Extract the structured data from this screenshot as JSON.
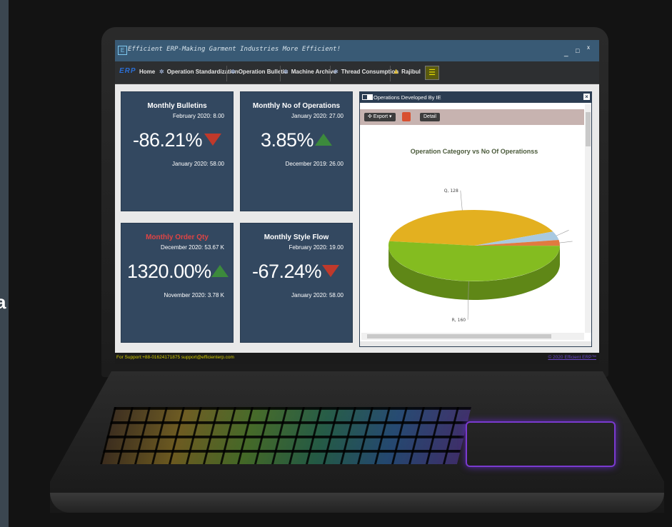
{
  "left_fragment": "a",
  "window": {
    "title": "Efficient ERP-Making Garment Industries More Efficient!",
    "controls": [
      "_",
      "□",
      "x"
    ]
  },
  "menu": {
    "logo": "ERP",
    "items": [
      {
        "label": "Home",
        "icon": "home-icon"
      },
      {
        "label": "Operation Standardization",
        "icon": "gears-icon"
      },
      {
        "label": "Operation Bulletin",
        "icon": "gears-icon"
      },
      {
        "label": "Machine Archive",
        "icon": "gears-icon"
      },
      {
        "label": "Thread Consumption",
        "icon": "gears-icon"
      },
      {
        "label": "Rajibul",
        "icon": "user-icon"
      }
    ]
  },
  "cards": [
    {
      "title": "Monthly Bulletins",
      "current": "February 2020: 8.00",
      "change": "-86.21%",
      "trend": "down",
      "previous": "January 2020: 58.00"
    },
    {
      "title": "Monthly No of Operations",
      "current": "January 2020: 27.00",
      "change": "3.85%",
      "trend": "up",
      "previous": "December 2019: 26.00"
    },
    {
      "title": "Monthly Order Qty",
      "current": "December 2020: 53.67 K",
      "change": "1320.00%",
      "trend": "up",
      "previous": "November 2020: 3.78 K"
    },
    {
      "title": "Monthly Style Flow",
      "current": "February 2020: 19.00",
      "change": "-67.24%",
      "trend": "down",
      "previous": "January 2020: 58.00"
    }
  ],
  "panel": {
    "title": "Operations Developed By IE",
    "export_label": "Export",
    "detail_label": "Detail"
  },
  "chart_data": {
    "type": "pie",
    "title": "Operation Category vs No Of Operationss",
    "slices": [
      {
        "label": "Q, 128",
        "value": 128,
        "color": "#e3b020"
      },
      {
        "label": "",
        "value": 12,
        "color": "#a9c9e0"
      },
      {
        "label": "",
        "value": 8,
        "color": "#e07a40"
      },
      {
        "label": "R, 160",
        "value": 160,
        "color": "#84bc20"
      }
    ]
  },
  "footer": {
    "support": "For Support:+88-01624171875 support@efficienterp.com",
    "copyright": "© 2020 Efficient ERP™"
  },
  "colors": {
    "card_bg": "#334860",
    "titlebar": "#395a75",
    "trend_down": "#c0392b",
    "trend_up": "#3c8a3c"
  }
}
